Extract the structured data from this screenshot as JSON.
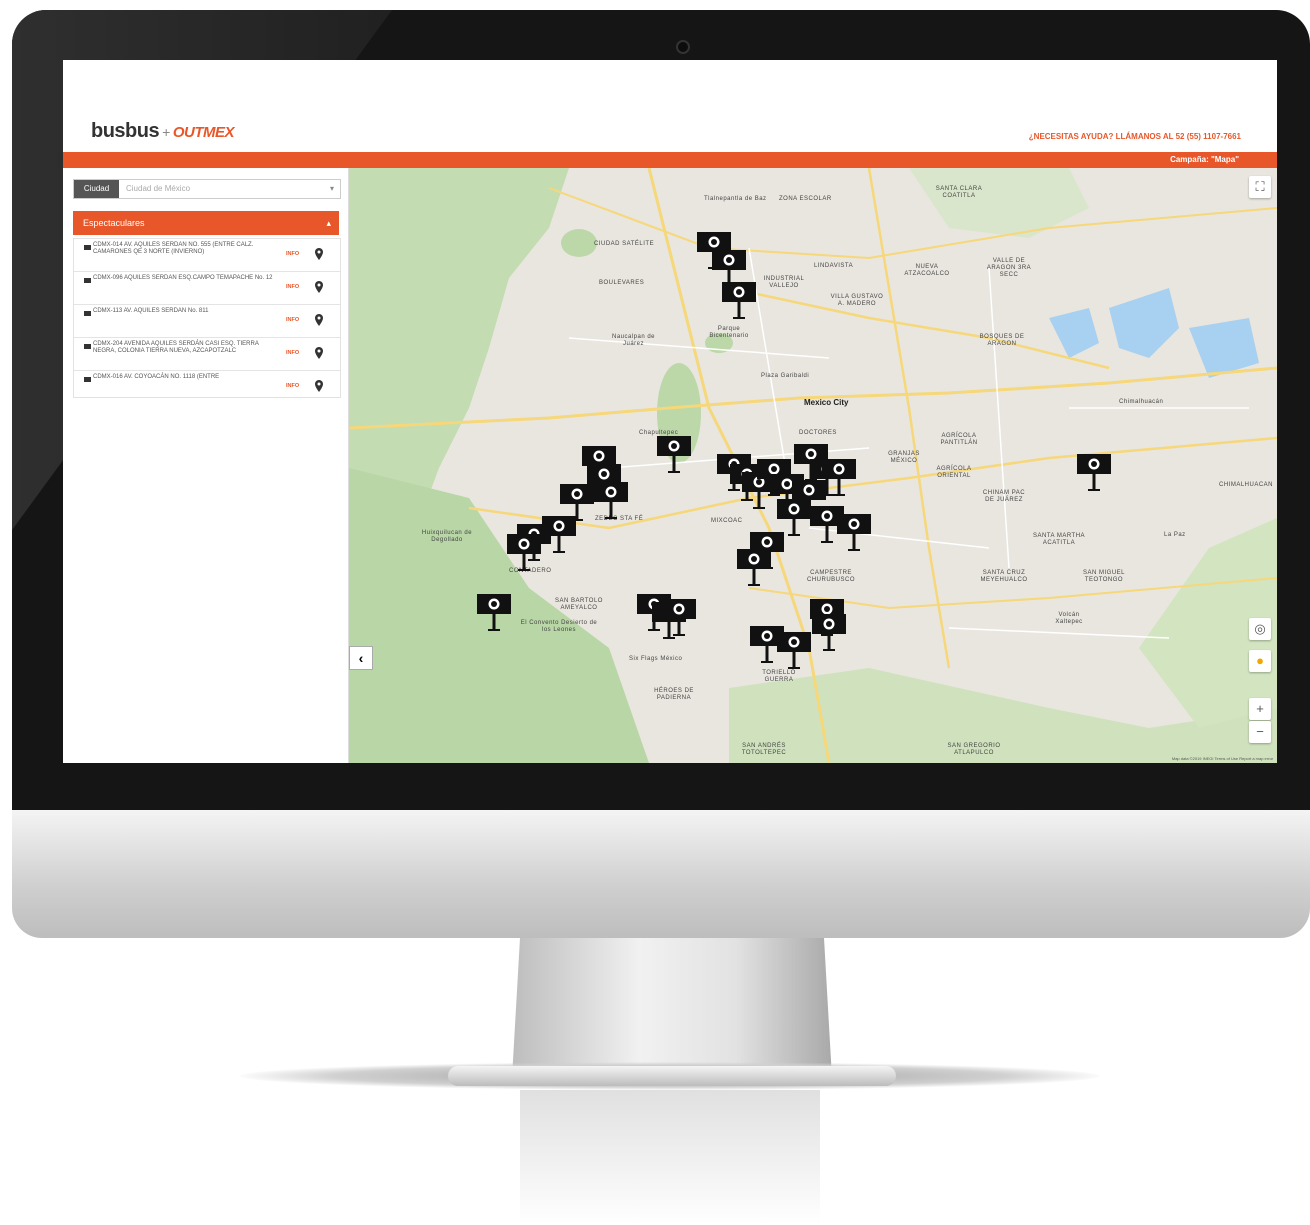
{
  "header": {
    "logo_main": "busbus",
    "logo_plus": "+",
    "logo_partner": "OUTMEX",
    "help_text": "¿NECESITAS AYUDA? LLÁMANOS AL 52 (55) 1107-7661",
    "campaign_text": "Campaña: \"Mapa\""
  },
  "sidebar": {
    "city_label": "Ciudad",
    "city_value": "Ciudad de México",
    "panel_title": "Espectaculares",
    "items": [
      {
        "text": "CDMX-014 AV. AQUILES SERDAN NO. 555 (ENTRE CALZ. CAMARONES QE 3 NORTE (INVIERNO)",
        "info": "INFO"
      },
      {
        "text": "CDMX-096 AQUILES SERDAN ESQ.CAMPO TEMAPACHE No. 12",
        "info": "INFO"
      },
      {
        "text": "CDMX-113 AV. AQUILES SERDAN No. 811",
        "info": "INFO"
      },
      {
        "text": "CDMX-204 AVENIDA AQUILES SERDÁN CASI ESQ. TIERRA NEGRA, COLONIA TIERRA NUEVA, AZCAPOTZALC",
        "info": "INFO"
      },
      {
        "text": "CDMX-016 AV. COYOACÁN NO. 1118 (ENTRE",
        "info": "INFO"
      }
    ]
  },
  "map": {
    "city_label": "Mexico City",
    "labels": [
      {
        "text": "Tlalnepantla de Baz"
      },
      {
        "text": "ZONA ESCOLAR"
      },
      {
        "text": "SANTA CLARA COATITLA"
      },
      {
        "text": "CIUDAD SATÉLITE"
      },
      {
        "text": "LINDAVISTA"
      },
      {
        "text": "NUEVA ATZACOALCO"
      },
      {
        "text": "VALLE DE ARAGON 3RA SECC"
      },
      {
        "text": "BOULEVARES"
      },
      {
        "text": "INDUSTRIAL VALLEJO"
      },
      {
        "text": "VILLA GUSTAVO A. MADERO"
      },
      {
        "text": "BOSQUES DE ARAGON"
      },
      {
        "text": "Naucalpan de Juárez"
      },
      {
        "text": "DOCTORES"
      },
      {
        "text": "GRANJAS MÉXICO"
      },
      {
        "text": "AGRÍCOLA PANTITLÁN"
      },
      {
        "text": "AGRÍCOLA ORIENTAL"
      },
      {
        "text": "Chimalhuacán"
      },
      {
        "text": "CHIMALHUACAN"
      },
      {
        "text": "ZEDEC STA FÉ"
      },
      {
        "text": "MIXCOAC"
      },
      {
        "text": "CHINAM PAC DE JUÁREZ"
      },
      {
        "text": "SANTA MARTHA ACATITLA"
      },
      {
        "text": "La Paz"
      },
      {
        "text": "Huixquilucan de Degollado"
      },
      {
        "text": "CONTADERO"
      },
      {
        "text": "CAMPESTRE CHURUBUSCO"
      },
      {
        "text": "SANTA CRUZ MEYEHUALCO"
      },
      {
        "text": "SAN MIGUEL TEOTONGO"
      },
      {
        "text": "SAN BARTOLO AMEYALCO"
      },
      {
        "text": "El Convento Desierto de los Leones"
      },
      {
        "text": "TORIELLO GUERRA"
      },
      {
        "text": "HÉROES DE PADIERNA"
      },
      {
        "text": "SAN ANDRÉS TOTOLTEPEC"
      },
      {
        "text": "SAN GREGORIO ATLAPULCO"
      },
      {
        "text": "Plaza Garibaldi"
      },
      {
        "text": "Chapultepec"
      },
      {
        "text": "Parque Bicentenario"
      },
      {
        "text": "Six Flags México"
      },
      {
        "text": "Volcán Xaltepec"
      }
    ],
    "footer": "Map data ©2019 INEGI   Terms of Use   Report a map error"
  },
  "colors": {
    "accent": "#e8572a",
    "billboard": "#111111"
  }
}
